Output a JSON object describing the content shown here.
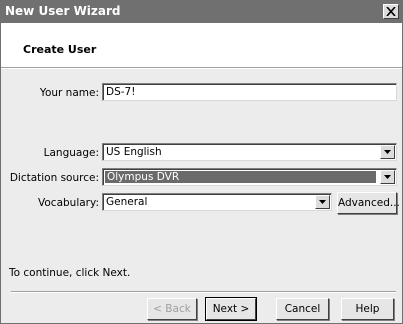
{
  "window": {
    "title": "New User Wizard",
    "close_icon": "close-icon"
  },
  "header": {
    "title": "Create User"
  },
  "form": {
    "name_label": "Your name:",
    "name_value": "DS-7!",
    "language_label": "Language:",
    "language_value": "US English",
    "dictation_label": "Dictation source:",
    "dictation_value": "Olympus DVR",
    "vocabulary_label": "Vocabulary:",
    "vocabulary_value": "General",
    "advanced_label": "Advanced..."
  },
  "footer": {
    "hint": "To continue, click Next.",
    "back_label": "< Back",
    "next_label": "Next >",
    "cancel_label": "Cancel",
    "help_label": "Help"
  }
}
